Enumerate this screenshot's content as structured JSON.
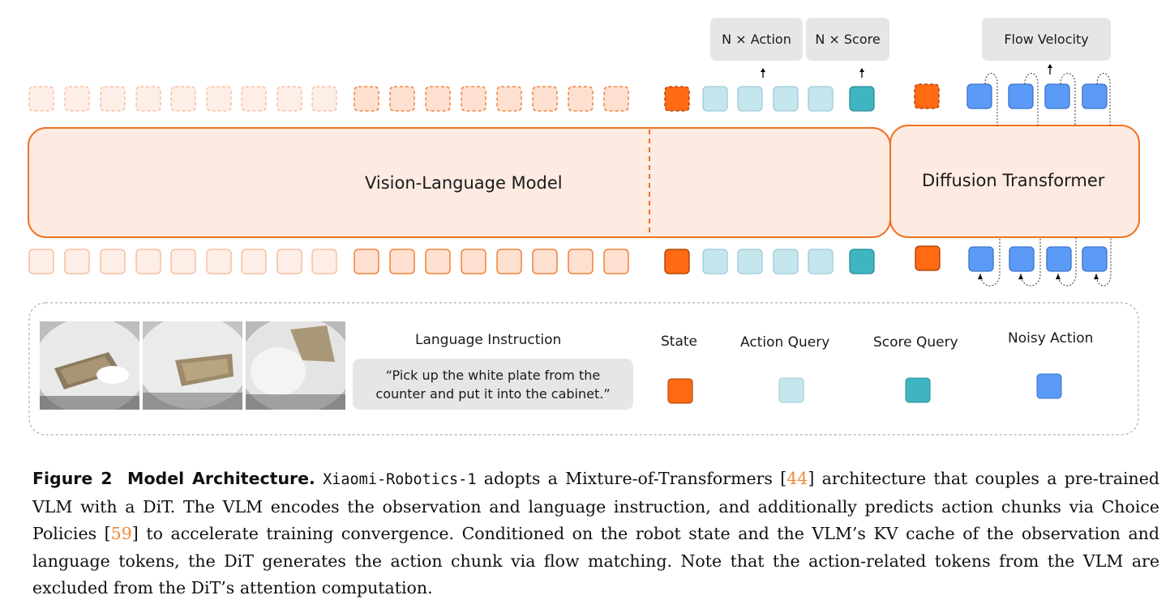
{
  "labels": {
    "vlm": "Vision-Language Model",
    "dit": "Diffusion Transformer",
    "n_action": "N × Action",
    "n_score": "N × Score",
    "flow_velocity": "Flow Velocity",
    "language_instruction": "Language Instruction",
    "state": "State",
    "action_query": "Action Query",
    "score_query": "Score Query",
    "noisy_action": "Noisy Action"
  },
  "instruction_text": "“Pick up the white plate from the\ncounter and put it into the cabinet.”",
  "colors": {
    "orange": "#ff6a13",
    "orange_border": "#f07020",
    "vlm_fill": "#fdebe2",
    "token_light": "#fdeee7",
    "token_mid": "#fde0d0",
    "action_query": "#c6e6ee",
    "score_query": "#3fb5c1",
    "noisy_action": "#5b9bf7"
  },
  "caption": {
    "figure_label": "Figure 2",
    "title": "Model Architecture.",
    "model_name": "Xiaomi-Robotics-1",
    "part1": " adopts a Mixture-of-Transformers ",
    "ref1": "44",
    "part2": " architecture that couples a pre-trained VLM with a DiT. The VLM encodes the observation and language instruction, and additionally predicts action chunks via Choice Policies ",
    "ref2": "59",
    "part3": " to accelerate training convergence. Conditioned on the robot state and the VLM’s KV cache of the observation and language tokens, the DiT generates the action chunk via flow matching. Note that the action-related tokens from the VLM are excluded from the DiT’s attention computation."
  }
}
